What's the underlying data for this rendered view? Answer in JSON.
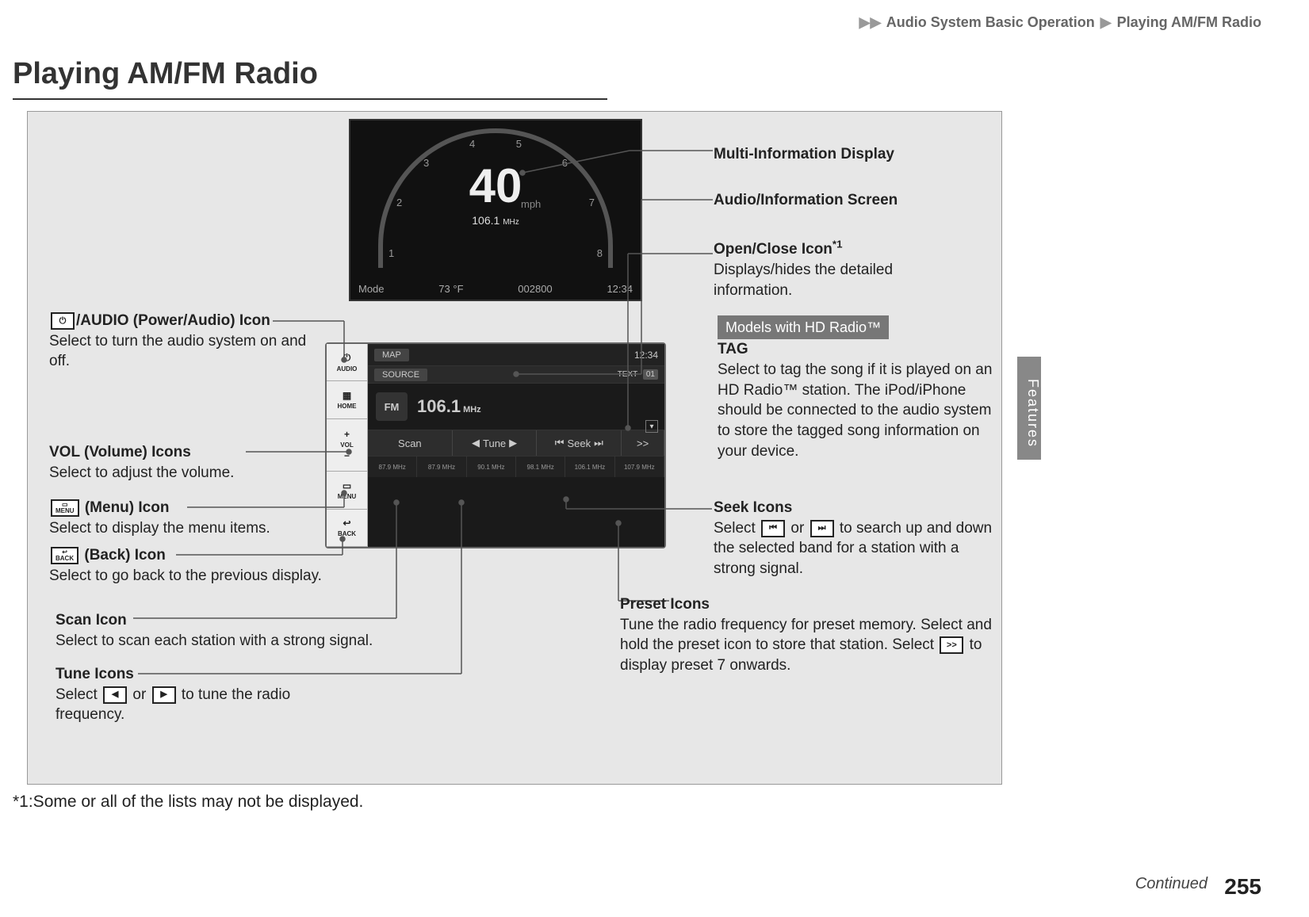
{
  "breadcrumb": {
    "sep": "▶▶",
    "a": "Audio System Basic Operation",
    "sep2": "▶",
    "b": "Playing AM/FM Radio"
  },
  "page_title": "Playing AM/FM Radio",
  "side_tab": "Features",
  "mid": {
    "speed": "40",
    "mph": "mph",
    "freq": "106.1",
    "freq_unit": "MHz",
    "ticks": [
      "1",
      "2",
      "3",
      "4",
      "5",
      "6",
      "7",
      "8"
    ],
    "bottom": {
      "mode": "Mode",
      "temp": "73 °F",
      "odo": "002800",
      "time": "12:34"
    }
  },
  "ais": {
    "sidebar": {
      "audio": "AUDIO",
      "home": "HOME",
      "vol": "VOL",
      "menu": "MENU",
      "back": "BACK"
    },
    "screen": {
      "tab_map": "MAP",
      "time": "12:34",
      "source": "SOURCE",
      "text_off": "TEXT",
      "hd_badge": "01",
      "band": "FM",
      "freq": "106.1",
      "freq_unit": "MHz",
      "open_close": "▾",
      "controls": {
        "scan": "Scan",
        "tune": "Tune",
        "seek": "Seek",
        "more": ">>"
      },
      "presets": [
        "87.9 MHz",
        "87.9 MHz",
        "90.1 MHz",
        "98.1 MHz",
        "106.1 MHz",
        "107.9 MHz"
      ]
    }
  },
  "callouts": {
    "power_audio": {
      "title_a": "/AUDIO (Power/Audio) Icon",
      "body": "Select to turn the audio system on and off."
    },
    "vol": {
      "title": "VOL (Volume) Icons",
      "body": "Select to adjust the volume."
    },
    "menu": {
      "icon": "MENU",
      "title": " (Menu) Icon",
      "body": "Select to display the menu items."
    },
    "back": {
      "icon": "BACK",
      "title": " (Back) Icon",
      "body": "Select to go back to the previous display."
    },
    "scan": {
      "title": "Scan Icon",
      "body": "Select to scan each station with a strong signal."
    },
    "tune": {
      "title": "Tune Icons",
      "body_a": "Select ",
      "body_b": " or ",
      "body_c": " to tune the radio frequency."
    },
    "mid_label": "Multi-Information Display",
    "ais_label": "Audio/Information Screen",
    "open_close": {
      "title": "Open/Close Icon",
      "sup": "*1",
      "body": "Displays/hides the detailed information."
    },
    "hd_badge": "Models with HD Radio™",
    "tag": {
      "title": "TAG",
      "body": "Select to tag the song if it is played on an HD Radio™ station. The iPod/iPhone should be connected to the audio system to store the tagged song information on your device."
    },
    "seek": {
      "title": "Seek Icons",
      "body_a": "Select ",
      "body_b": " or ",
      "body_c": " to search up and down the selected band for a station with a strong signal."
    },
    "preset": {
      "title": "Preset Icons",
      "body_a": "Tune the radio frequency for preset memory. Select and hold the preset icon to store that station. Select ",
      "body_b": " to display preset 7 onwards.",
      "more_icon": ">>"
    }
  },
  "footnote": "*1:Some or all of the lists may not be displayed.",
  "continued": "Continued",
  "page_number": "255"
}
